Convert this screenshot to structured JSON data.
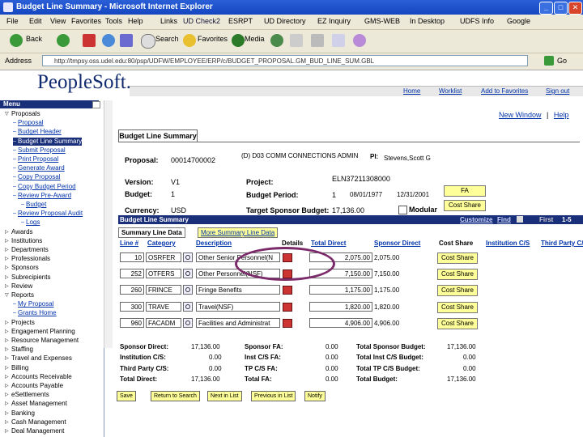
{
  "window": {
    "title": "Budget Line Summary - Microsoft Internet Explorer"
  },
  "menubar": [
    "File",
    "Edit",
    "View",
    "Favorites",
    "Tools",
    "Help"
  ],
  "links_bar": [
    "Links",
    "UD Check2",
    "ESRPT",
    "UD Directory",
    "EZ Inquiry",
    "GMS-WEB",
    "In Desktop",
    "UDFS Info",
    "Google"
  ],
  "toolbar": {
    "back": "Back",
    "search": "Search",
    "favorites": "Favorites",
    "media": "Media"
  },
  "address": {
    "label": "Address",
    "url": "http://tmpsy.oss.udel.edu:80/psp/UDFW/EMPLOYEE/ERP/c/BUDGET_PROPOSAL.GM_BUD_LINE_SUM.GBL",
    "go": "Go"
  },
  "peoplesoft": {
    "logo": "PeopleSoft.",
    "links": [
      "Home",
      "Worklist",
      "Add to Favorites",
      "Sign out"
    ]
  },
  "menu": {
    "title": "Menu",
    "items": [
      {
        "label": "Proposals",
        "indent": 0,
        "kind": "folder-open"
      },
      {
        "label": "Proposal",
        "indent": 1,
        "kind": "link"
      },
      {
        "label": "Budget Header",
        "indent": 1,
        "kind": "link"
      },
      {
        "label": "Budget Line Summary",
        "indent": 1,
        "kind": "selected"
      },
      {
        "label": "Submit Proposal",
        "indent": 1,
        "kind": "link"
      },
      {
        "label": "Print Proposal",
        "indent": 1,
        "kind": "link"
      },
      {
        "label": "Generate Award",
        "indent": 1,
        "kind": "link"
      },
      {
        "label": "Copy Proposal",
        "indent": 1,
        "kind": "link"
      },
      {
        "label": "Copy Budget Period",
        "indent": 1,
        "kind": "link"
      },
      {
        "label": "Review Pre-Award",
        "indent": 1,
        "kind": "link"
      },
      {
        "label": "Budget",
        "indent": 2,
        "kind": "link"
      },
      {
        "label": "Review Proposal Audit",
        "indent": 1,
        "kind": "link"
      },
      {
        "label": "Logs",
        "indent": 2,
        "kind": "link"
      },
      {
        "label": "Awards",
        "indent": 0,
        "kind": "folder"
      },
      {
        "label": "Institutions",
        "indent": 0,
        "kind": "folder"
      },
      {
        "label": "Departments",
        "indent": 0,
        "kind": "folder"
      },
      {
        "label": "Professionals",
        "indent": 0,
        "kind": "folder"
      },
      {
        "label": "Sponsors",
        "indent": 0,
        "kind": "folder"
      },
      {
        "label": "Subrecipients",
        "indent": 0,
        "kind": "folder"
      },
      {
        "label": "Review",
        "indent": 0,
        "kind": "folder"
      },
      {
        "label": "Reports",
        "indent": 0,
        "kind": "folder-open"
      },
      {
        "label": "My Proposal",
        "indent": 1,
        "kind": "link"
      },
      {
        "label": "Grants Home",
        "indent": 1,
        "kind": "link"
      },
      {
        "label": "Projects",
        "indent": 0,
        "kind": "folder"
      },
      {
        "label": "Engagement Planning",
        "indent": 0,
        "kind": "folder"
      },
      {
        "label": "Resource Management",
        "indent": 0,
        "kind": "folder"
      },
      {
        "label": "Staffing",
        "indent": 0,
        "kind": "folder"
      },
      {
        "label": "Travel and Expenses",
        "indent": 0,
        "kind": "folder"
      },
      {
        "label": "Billing",
        "indent": 0,
        "kind": "folder"
      },
      {
        "label": "Accounts Receivable",
        "indent": 0,
        "kind": "folder"
      },
      {
        "label": "Accounts Payable",
        "indent": 0,
        "kind": "folder"
      },
      {
        "label": "eSettlements",
        "indent": 0,
        "kind": "folder"
      },
      {
        "label": "Asset Management",
        "indent": 0,
        "kind": "folder"
      },
      {
        "label": "Banking",
        "indent": 0,
        "kind": "folder"
      },
      {
        "label": "Cash Management",
        "indent": 0,
        "kind": "folder"
      },
      {
        "label": "Deal Management",
        "indent": 0,
        "kind": "folder"
      }
    ]
  },
  "page": {
    "top_links": {
      "new_window": "New Window",
      "help": "Help"
    },
    "tab": "Budget Line Summary",
    "header": {
      "proposal_label": "Proposal:",
      "proposal_value": "00014700002",
      "proposal_desc": "(D) D03 COMM CONNECTIONS ADMIN",
      "pi_label": "PI:",
      "pi_value": "Stevens,Scott G",
      "version_label": "Version:",
      "version_value": "V1",
      "project_label": "Project:",
      "project_value": "ELN37211308000",
      "budget_label": "Budget:",
      "budget_value": "1",
      "period_label": "Budget Period:",
      "period_num": "1",
      "period_from": "08/01/1977",
      "period_to": "12/31/2001",
      "currency_label": "Currency:",
      "currency_value": "USD",
      "target_label": "Target Sponsor Budget:",
      "target_value": "17,136.00",
      "modular_label": "Modular",
      "fa_button": "FA",
      "cost_share_button": "Cost Share"
    },
    "grid": {
      "title": "Budget Line Summary",
      "nav": {
        "customize": "Customize",
        "find": "Find",
        "first": "First",
        "range": "1-5"
      },
      "subtabs": [
        "Summary Line Data",
        "More Summary Line Data"
      ],
      "columns": [
        "Line #",
        "Category",
        "Description",
        "Details",
        "Total Direct",
        "Sponsor Direct",
        "Cost Share",
        "Institution C/S",
        "Third Party C/S"
      ],
      "rows": [
        {
          "line": "10",
          "category": "OSRFER",
          "description": "Other Senior Personnel(N",
          "total": "2,075.00",
          "sponsor": "2,075.00",
          "cost_share": "Cost Share"
        },
        {
          "line": "252",
          "category": "OTFERS",
          "description": "Other Personnel(NSF)",
          "total": "7,150.00",
          "sponsor": "7,150.00",
          "cost_share": "Cost Share"
        },
        {
          "line": "260",
          "category": "FRINCE",
          "description": "Fringe Benefits",
          "total": "1,175.00",
          "sponsor": "1,175.00",
          "cost_share": "Cost Share"
        },
        {
          "line": "300",
          "category": "TRAVE",
          "description": "Travel(NSF)",
          "total": "1,820.00",
          "sponsor": "1,820.00",
          "cost_share": "Cost Share"
        },
        {
          "line": "960",
          "category": "FACADM",
          "description": "Facilities and Administrat",
          "total": "4,906.00",
          "sponsor": "4,906.00",
          "cost_share": "Cost Share"
        }
      ]
    },
    "totals": {
      "col1": [
        {
          "label": "Sponsor Direct:",
          "value": "17,136.00"
        },
        {
          "label": "Institution C/S:",
          "value": "0.00"
        },
        {
          "label": "Third Party C/S:",
          "value": "0.00"
        },
        {
          "label": "Total Direct:",
          "value": "17,136.00"
        }
      ],
      "col2": [
        {
          "label": "Sponsor FA:",
          "value": "0.00"
        },
        {
          "label": "Inst C/S FA:",
          "value": "0.00"
        },
        {
          "label": "TP C/S FA:",
          "value": "0.00"
        },
        {
          "label": "Total FA:",
          "value": "0.00"
        }
      ],
      "col3": [
        {
          "label": "Total Sponsor Budget:",
          "value": "17,136.00"
        },
        {
          "label": "Total Inst C/S Budget:",
          "value": "0.00"
        },
        {
          "label": "Total TP C/S Budget:",
          "value": "0.00"
        },
        {
          "label": "Total Budget:",
          "value": "17,136.00"
        }
      ]
    },
    "bottom_buttons": [
      "Save",
      "Return to Search",
      "Next in List",
      "Previous in List",
      "Notify"
    ]
  },
  "colors": {
    "ps_blue": "#1a2f7a",
    "annotation": "#7b2a6a",
    "button_yellow": "#ffff99",
    "xp_title": "#1446c0"
  }
}
